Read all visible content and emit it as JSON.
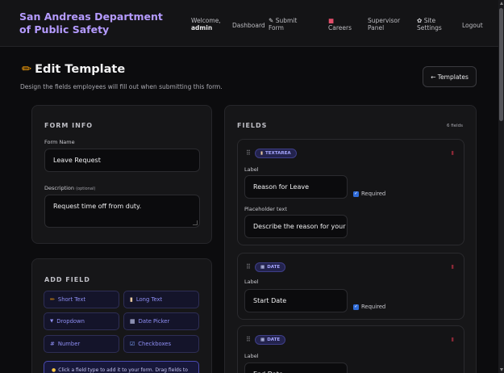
{
  "nav": {
    "brand": "San Andreas Department of Public Safety",
    "welcome_prefix": "Welcome,",
    "welcome_user": "admin",
    "dashboard": "Dashboard",
    "submit_form": "Submit Form",
    "careers": "Careers",
    "supervisor_panel": "Supervisor Panel",
    "site_settings": "Site Settings",
    "logout": "Logout"
  },
  "page": {
    "title": "Edit Template",
    "subtitle": "Design the fields employees will fill out when submitting this form.",
    "back_button": "← Templates"
  },
  "form_info": {
    "heading": "FORM INFO",
    "name_label": "Form Name",
    "name_value": "Leave Request",
    "desc_label": "Description",
    "desc_optional": "(optional)",
    "desc_value": "Request time off from duty."
  },
  "add_field": {
    "heading": "ADD FIELD",
    "buttons": [
      {
        "icon": "pencil-icon",
        "glyph": "✏",
        "label": "Short Text"
      },
      {
        "icon": "document-icon",
        "glyph": "▮",
        "label": "Long Text"
      },
      {
        "icon": "dropdown-icon",
        "glyph": "▼",
        "label": "Dropdown"
      },
      {
        "icon": "calendar-icon",
        "glyph": "▦",
        "label": "Date Picker"
      },
      {
        "icon": "hash-icon",
        "glyph": "#",
        "label": "Number"
      },
      {
        "icon": "checkbox-icon",
        "glyph": "☑",
        "label": "Checkboxes"
      }
    ],
    "hint": "Click a field type to add it to your form. Drag fields to"
  },
  "fields": {
    "heading": "FIELDS",
    "count": "6 fields",
    "items": [
      {
        "type": "TEXTAREA",
        "label_caption": "Label",
        "label_value": "Reason for Leave",
        "required": "Required",
        "placeholder_caption": "Placeholder text",
        "placeholder_value": "Describe the reason for your leav"
      },
      {
        "type": "DATE",
        "label_caption": "Label",
        "label_value": "Start Date",
        "required": "Required"
      },
      {
        "type": "DATE",
        "label_caption": "Label",
        "label_value": "End Date"
      }
    ]
  },
  "colors": {
    "brand": "#b59bff",
    "accent": "#8f8ff5",
    "background": "#0c0c0e"
  }
}
